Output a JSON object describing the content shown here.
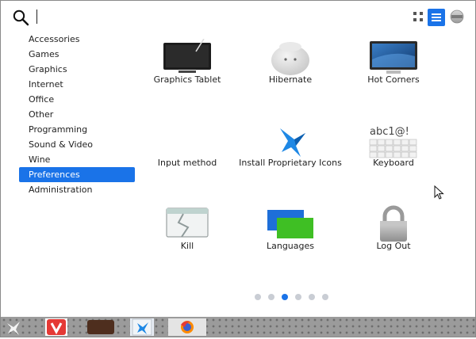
{
  "search": {
    "value": "",
    "placeholder": ""
  },
  "view_toggle": {
    "active": "list"
  },
  "sidebar": {
    "items": [
      {
        "label": "Accessories"
      },
      {
        "label": "Games"
      },
      {
        "label": "Graphics"
      },
      {
        "label": "Internet"
      },
      {
        "label": "Office"
      },
      {
        "label": "Other"
      },
      {
        "label": "Programming"
      },
      {
        "label": "Sound & Video"
      },
      {
        "label": "Wine"
      },
      {
        "label": "Preferences"
      },
      {
        "label": "Administration"
      }
    ],
    "active_index": 9
  },
  "apps": [
    {
      "label": "Graphics Tablet",
      "icon": "graphics-tablet-icon"
    },
    {
      "label": "Hibernate",
      "icon": "hibernate-icon"
    },
    {
      "label": "Hot Corners",
      "icon": "hot-corners-icon"
    },
    {
      "label": "Input method",
      "icon": "input-method-icon"
    },
    {
      "label": "Install Proprietary Icons",
      "icon": "install-proprietary-icons-icon"
    },
    {
      "label": "Keyboard",
      "icon": "keyboard-icon"
    },
    {
      "label": "Kill",
      "icon": "kill-icon"
    },
    {
      "label": "Languages",
      "icon": "languages-icon"
    },
    {
      "label": "Log Out",
      "icon": "log-out-icon"
    }
  ],
  "pager": {
    "pages": 6,
    "current": 3
  },
  "keyboard_icon_text": "abc1@!",
  "dock": {
    "items": [
      {
        "icon": "app-launcher-icon"
      },
      {
        "icon": "vivaldi-icon"
      },
      {
        "icon": "file-manager-icon"
      },
      {
        "icon": "app-icon"
      },
      {
        "icon": "firefox-icon"
      }
    ]
  },
  "colors": {
    "accent": "#1a73e8",
    "dock": "#9b9b9b"
  }
}
